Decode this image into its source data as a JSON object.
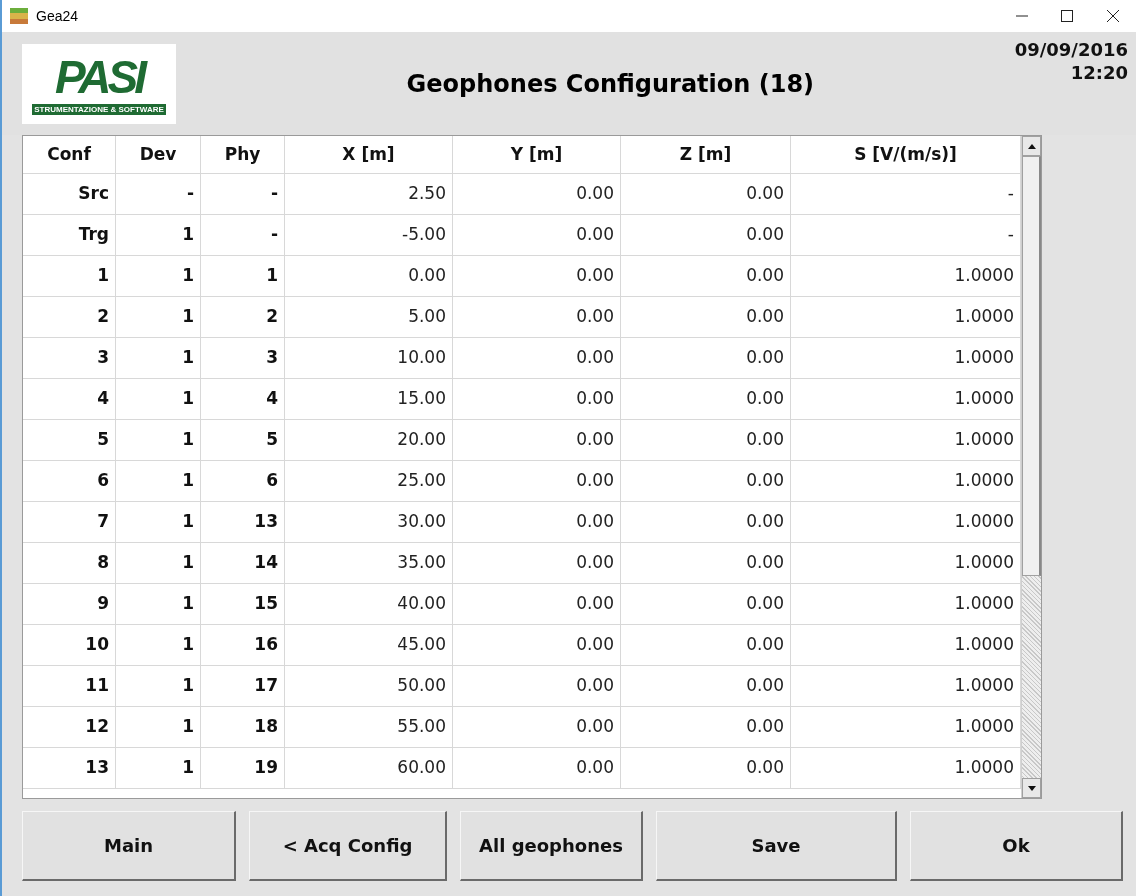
{
  "window": {
    "title": "Gea24"
  },
  "logo": {
    "mark": "PASI",
    "tagline": "STRUMENTAZIONE & SOFTWARE"
  },
  "header": {
    "title": "Geophones Configuration (18)",
    "date": "09/09/2016",
    "time": "12:20"
  },
  "table": {
    "columns": [
      "Conf",
      "Dev",
      "Phy",
      "X [m]",
      "Y [m]",
      "Z [m]",
      "S [V/(m/s)]"
    ],
    "rows": [
      [
        "Src",
        "-",
        "-",
        "2.50",
        "0.00",
        "0.00",
        "-"
      ],
      [
        "Trg",
        "1",
        "-",
        "-5.00",
        "0.00",
        "0.00",
        "-"
      ],
      [
        "1",
        "1",
        "1",
        "0.00",
        "0.00",
        "0.00",
        "1.0000"
      ],
      [
        "2",
        "1",
        "2",
        "5.00",
        "0.00",
        "0.00",
        "1.0000"
      ],
      [
        "3",
        "1",
        "3",
        "10.00",
        "0.00",
        "0.00",
        "1.0000"
      ],
      [
        "4",
        "1",
        "4",
        "15.00",
        "0.00",
        "0.00",
        "1.0000"
      ],
      [
        "5",
        "1",
        "5",
        "20.00",
        "0.00",
        "0.00",
        "1.0000"
      ],
      [
        "6",
        "1",
        "6",
        "25.00",
        "0.00",
        "0.00",
        "1.0000"
      ],
      [
        "7",
        "1",
        "13",
        "30.00",
        "0.00",
        "0.00",
        "1.0000"
      ],
      [
        "8",
        "1",
        "14",
        "35.00",
        "0.00",
        "0.00",
        "1.0000"
      ],
      [
        "9",
        "1",
        "15",
        "40.00",
        "0.00",
        "0.00",
        "1.0000"
      ],
      [
        "10",
        "1",
        "16",
        "45.00",
        "0.00",
        "0.00",
        "1.0000"
      ],
      [
        "11",
        "1",
        "17",
        "50.00",
        "0.00",
        "0.00",
        "1.0000"
      ],
      [
        "12",
        "1",
        "18",
        "55.00",
        "0.00",
        "0.00",
        "1.0000"
      ],
      [
        "13",
        "1",
        "19",
        "60.00",
        "0.00",
        "0.00",
        "1.0000"
      ]
    ]
  },
  "buttons": [
    "Main",
    "< Acq Config",
    "All geophones",
    "Save",
    "Ok"
  ]
}
